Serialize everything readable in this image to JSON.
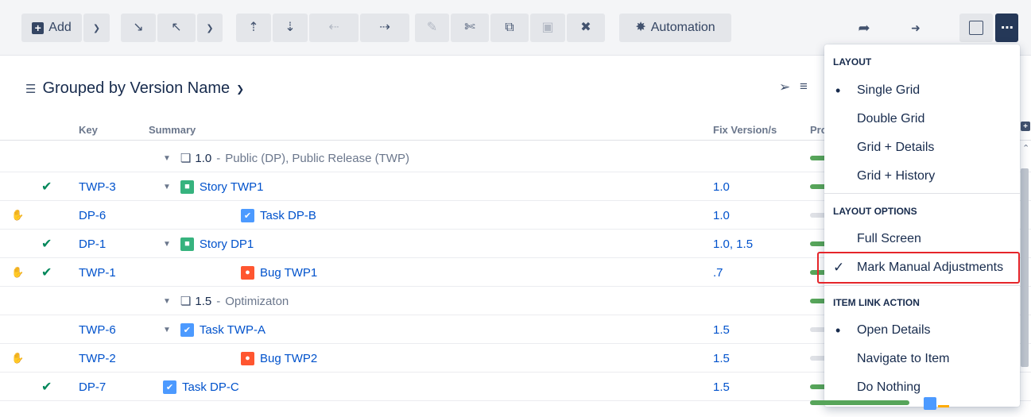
{
  "toolbar": {
    "add_label": "Add",
    "automation_label": "Automation"
  },
  "heading": {
    "title": "Grouped by Version Name"
  },
  "columns": {
    "key": "Key",
    "summary": "Summary",
    "fix_version": "Fix Version/s",
    "progress": "Pro"
  },
  "rows": [
    {
      "type": "version",
      "version": "1.0",
      "sep": "-",
      "desc": "Public (DP), Public Release (TWP)",
      "progress": "green"
    },
    {
      "type": "issue",
      "check": true,
      "hand": false,
      "key": "TWP-3",
      "issue_type": "story",
      "summary": "Story TWP1",
      "indent": 1,
      "expand": true,
      "fix": "1.0",
      "progress": "green"
    },
    {
      "type": "issue",
      "check": false,
      "hand": true,
      "key": "DP-6",
      "issue_type": "task",
      "summary": "Task DP-B",
      "indent": 2,
      "expand": false,
      "fix": "1.0",
      "progress": "grey"
    },
    {
      "type": "issue",
      "check": true,
      "hand": false,
      "key": "DP-1",
      "issue_type": "story",
      "summary": "Story DP1",
      "indent": 1,
      "expand": true,
      "fix": "1.0, 1.5",
      "progress": "green"
    },
    {
      "type": "issue",
      "check": true,
      "hand": true,
      "key": "TWP-1",
      "issue_type": "bug",
      "summary": "Bug TWP1",
      "indent": 2,
      "expand": false,
      "fix": ".7",
      "progress": "green"
    },
    {
      "type": "version",
      "version": "1.5",
      "sep": "-",
      "desc": "Optimizaton",
      "progress": "green"
    },
    {
      "type": "issue",
      "check": false,
      "hand": false,
      "key": "TWP-6",
      "issue_type": "task",
      "summary": "Task TWP-A",
      "indent": 1,
      "expand": true,
      "fix": "1.5",
      "progress": "grey"
    },
    {
      "type": "issue",
      "check": false,
      "hand": true,
      "key": "TWP-2",
      "issue_type": "bug",
      "summary": "Bug TWP2",
      "indent": 2,
      "expand": false,
      "fix": "1.5",
      "progress": "grey"
    },
    {
      "type": "issue",
      "check": true,
      "hand": false,
      "key": "DP-7",
      "issue_type": "task",
      "summary": "Task DP-C",
      "indent": 1,
      "expand": false,
      "fix": "1.5",
      "progress": "green"
    }
  ],
  "menu": {
    "layout_header": "LAYOUT",
    "layout_items": [
      {
        "label": "Single Grid",
        "selected": true
      },
      {
        "label": "Double Grid",
        "selected": false
      },
      {
        "label": "Grid + Details",
        "selected": false
      },
      {
        "label": "Grid + History",
        "selected": false
      }
    ],
    "options_header": "LAYOUT OPTIONS",
    "options_items": [
      {
        "label": "Full Screen",
        "checked": false
      },
      {
        "label": "Mark Manual Adjustments",
        "checked": true
      }
    ],
    "link_header": "ITEM LINK ACTION",
    "link_items": [
      {
        "label": "Open Details",
        "selected": true
      },
      {
        "label": "Navigate to Item",
        "selected": false
      },
      {
        "label": "Do Nothing",
        "selected": false
      }
    ]
  },
  "colors": {
    "link": "#0052cc",
    "check_green": "#00875a",
    "progress_green": "#57a55a",
    "highlight_red": "#e5252a",
    "menu_button": "#253858"
  }
}
